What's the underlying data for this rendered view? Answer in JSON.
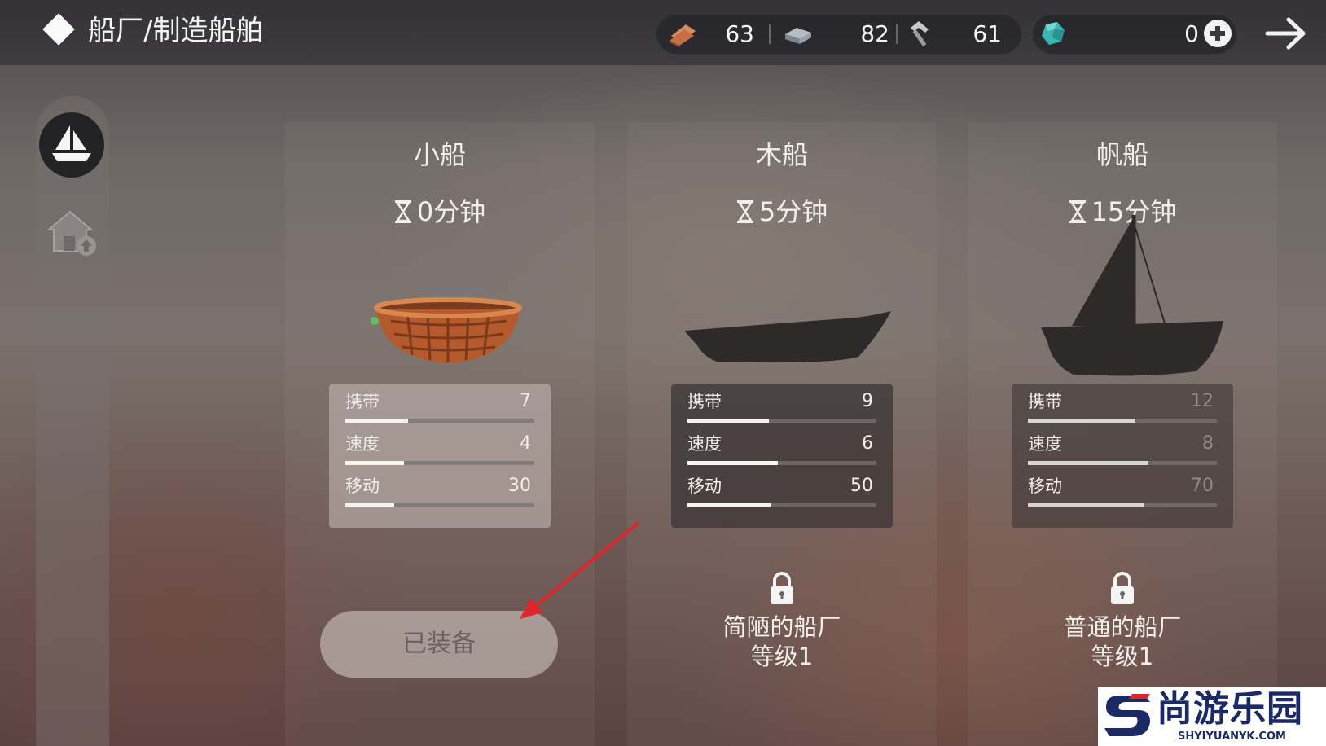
{
  "header": {
    "title": "船厂/制造船舶",
    "resources": [
      {
        "icon": "wood-plank-icon",
        "value": "63"
      },
      {
        "icon": "iron-ingot-icon",
        "value": "82"
      },
      {
        "icon": "hammer-icon",
        "value": "61"
      }
    ],
    "gems": {
      "icon": "gem-icon",
      "value": "0"
    }
  },
  "sidebar": {
    "items": [
      {
        "icon": "sailboat-icon",
        "active": true
      },
      {
        "icon": "home-upgrade-icon",
        "active": false
      }
    ]
  },
  "boats": [
    {
      "name": "小船",
      "time": "0分钟",
      "stats": [
        {
          "label": "携带",
          "value": "7",
          "fill": 0.33
        },
        {
          "label": "速度",
          "value": "4",
          "fill": 0.31
        },
        {
          "label": "移动",
          "value": "30",
          "fill": 0.26
        }
      ],
      "button_label": "已装备"
    },
    {
      "name": "木船",
      "time": "5分钟",
      "stats": [
        {
          "label": "携带",
          "value": "9",
          "fill": 0.43
        },
        {
          "label": "速度",
          "value": "6",
          "fill": 0.48
        },
        {
          "label": "移动",
          "value": "50",
          "fill": 0.44
        }
      ],
      "requirement": [
        "简陋的船厂",
        "等级1"
      ]
    },
    {
      "name": "帆船",
      "time": "15分钟",
      "stats": [
        {
          "label": "携带",
          "value": "12",
          "fill": 0.57
        },
        {
          "label": "速度",
          "value": "8",
          "fill": 0.64
        },
        {
          "label": "移动",
          "value": "70",
          "fill": 0.61
        }
      ],
      "requirement": [
        "普通的船厂",
        "等级1"
      ]
    }
  ],
  "watermark": {
    "name": "尚游乐园",
    "site": "SHYIYUANYK.COM"
  },
  "colors": {
    "annotation_arrow": "#e0262a",
    "watermark_blue": "#1a2a66"
  }
}
